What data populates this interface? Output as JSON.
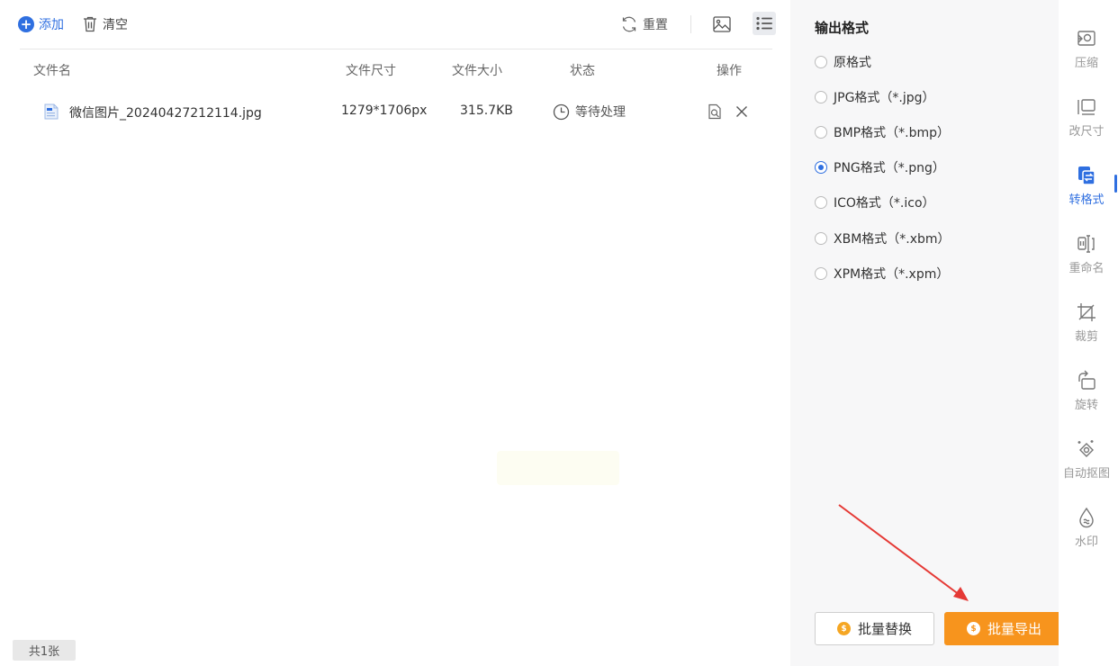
{
  "toolbar": {
    "add_label": "添加",
    "clear_label": "清空",
    "reset_label": "重置"
  },
  "table": {
    "columns": [
      "文件名",
      "文件尺寸",
      "文件大小",
      "状态",
      "操作"
    ],
    "rows": [
      {
        "filename": "微信图片_20240427212114.jpg",
        "dimensions": "1279*1706px",
        "size": "315.7KB",
        "status": "等待处理"
      }
    ]
  },
  "footer": {
    "count_label": "共1张"
  },
  "panel": {
    "title": "输出格式",
    "options": [
      {
        "label": "原格式",
        "selected": false
      },
      {
        "label": "JPG格式（*.jpg）",
        "selected": false
      },
      {
        "label": "BMP格式（*.bmp）",
        "selected": false
      },
      {
        "label": "PNG格式（*.png）",
        "selected": true
      },
      {
        "label": "ICO格式（*.ico）",
        "selected": false
      },
      {
        "label": "XBM格式（*.xbm）",
        "selected": false
      },
      {
        "label": "XPM格式（*.xpm）",
        "selected": false
      }
    ],
    "replace_button": "批量替换",
    "export_button": "批量导出"
  },
  "nav": {
    "items": [
      {
        "label": "压缩",
        "icon": "compress-icon"
      },
      {
        "label": "改尺寸",
        "icon": "resize-icon"
      },
      {
        "label": "转格式",
        "icon": "convert-format-icon",
        "active": true
      },
      {
        "label": "重命名",
        "icon": "rename-icon"
      },
      {
        "label": "裁剪",
        "icon": "crop-icon"
      },
      {
        "label": "旋转",
        "icon": "rotate-icon"
      },
      {
        "label": "自动抠图",
        "icon": "auto-cutout-icon"
      },
      {
        "label": "水印",
        "icon": "watermark-icon"
      }
    ]
  },
  "colors": {
    "accent": "#2f6fe0",
    "export_button": "#f7941d",
    "arrow": "#e53935"
  }
}
